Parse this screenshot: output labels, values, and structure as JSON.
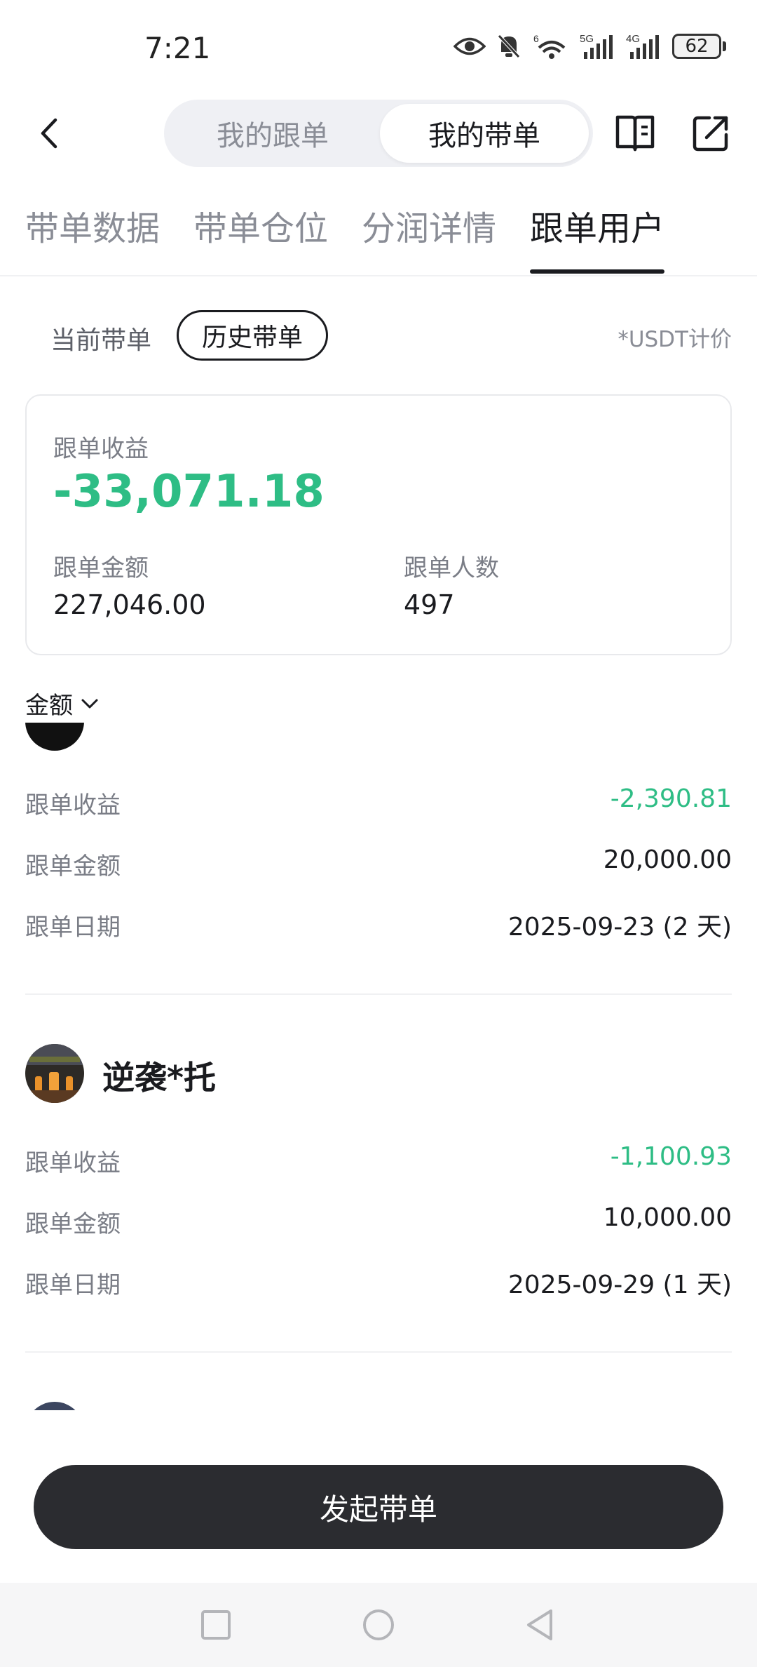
{
  "status_bar": {
    "time": "7:21",
    "battery": "62",
    "signal_labels": [
      "6",
      "5G",
      "4G"
    ]
  },
  "nav": {
    "segments": [
      "我的跟单",
      "我的带单"
    ],
    "active_segment": 1
  },
  "tabs": [
    "带单数据",
    "带单仓位",
    "分润详情",
    "跟单用户"
  ],
  "active_tab": 3,
  "subfilter": {
    "current": "当前带单",
    "history": "历史带单",
    "note": "*USDT计价"
  },
  "summary": {
    "profit_label": "跟单收益",
    "profit_value": "-33,071.18",
    "amount_label": "跟单金额",
    "amount_value": "227,046.00",
    "count_label": "跟单人数",
    "count_value": "497"
  },
  "sort": {
    "label": "金额"
  },
  "list": {
    "row_labels": {
      "profit": "跟单收益",
      "amount": "跟单金额",
      "date": "跟单日期"
    },
    "items": [
      {
        "name": "",
        "profit": "-2,390.81",
        "amount": "20,000.00",
        "date": "2025-09-23 (2 天)"
      },
      {
        "name": "逆袭*托",
        "profit": "-1,100.93",
        "amount": "10,000.00",
        "date": "2025-09-29 (1 天)"
      }
    ]
  },
  "cta": {
    "label": "发起带单"
  },
  "colors": {
    "accent_negative": "#2ebd85",
    "primary_dark": "#2b2c30"
  }
}
